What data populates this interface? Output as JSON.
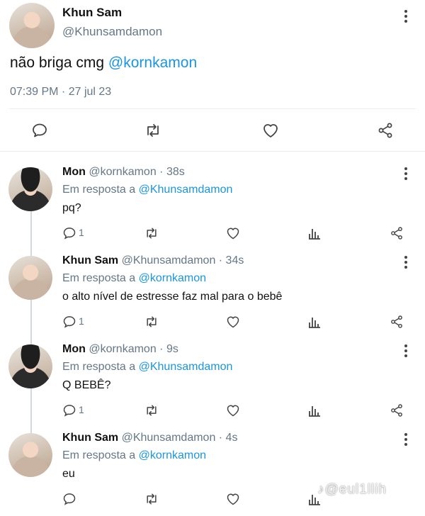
{
  "main_tweet": {
    "name": "Khun Sam",
    "handle": "@Khunsamdamon",
    "text": "não briga cmg ",
    "mention": "@kornkamon",
    "timestamp": "07:39 PM · 27 jul 23"
  },
  "replies": [
    {
      "name": "Mon",
      "handle": "@kornkamon · 38s",
      "in_reply_prefix": "Em resposta a ",
      "in_reply_to": "@Khunsamdamon",
      "text": "pq?",
      "reply_count": "1"
    },
    {
      "name": "Khun Sam",
      "handle": "@Khunsamdamon · 34s",
      "in_reply_prefix": "Em resposta a ",
      "in_reply_to": "@kornkamon",
      "text": "o alto nível de estresse faz mal para o bebê",
      "reply_count": "1"
    },
    {
      "name": "Mon",
      "handle": "@kornkamon · 9s",
      "in_reply_prefix": "Em resposta a ",
      "in_reply_to": "@Khunsamdamon",
      "text": "Q BEBÊ?",
      "reply_count": "1"
    },
    {
      "name": "Khun Sam",
      "handle": "@Khunsamdamon · 4s",
      "in_reply_prefix": "Em resposta a ",
      "in_reply_to": "@kornkamon",
      "text": "eu",
      "reply_count": ""
    }
  ],
  "watermark": "♪@eul1llih",
  "icons": [
    "kebab-menu-icon",
    "comment-icon",
    "retweet-icon",
    "heart-icon",
    "share-icon",
    "analytics-icon"
  ],
  "colors": {
    "link": "#1b95e0",
    "muted": "#657786",
    "divider": "#e6ecf0"
  }
}
